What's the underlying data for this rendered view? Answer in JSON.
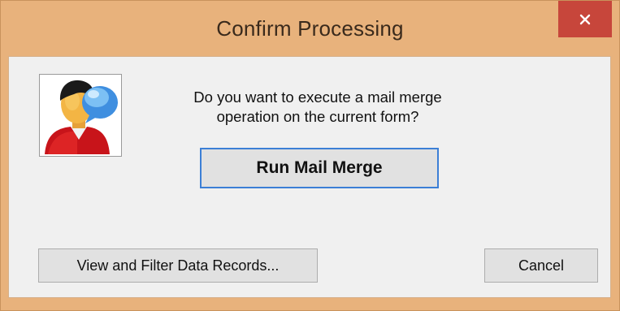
{
  "window": {
    "title": "Confirm Processing",
    "close_glyph": "✕",
    "colors": {
      "frame": "#e8b27c",
      "close": "#c7463b",
      "client": "#f0f0f0",
      "focus": "#3c7fd6"
    }
  },
  "dialog": {
    "icon": "user-chat-icon",
    "message_line1": "Do you want to execute a mail merge",
    "message_line2": "operation on the current form?",
    "primary_button": "Run Mail Merge",
    "view_button": "View and Filter Data Records...",
    "cancel_button": "Cancel"
  }
}
